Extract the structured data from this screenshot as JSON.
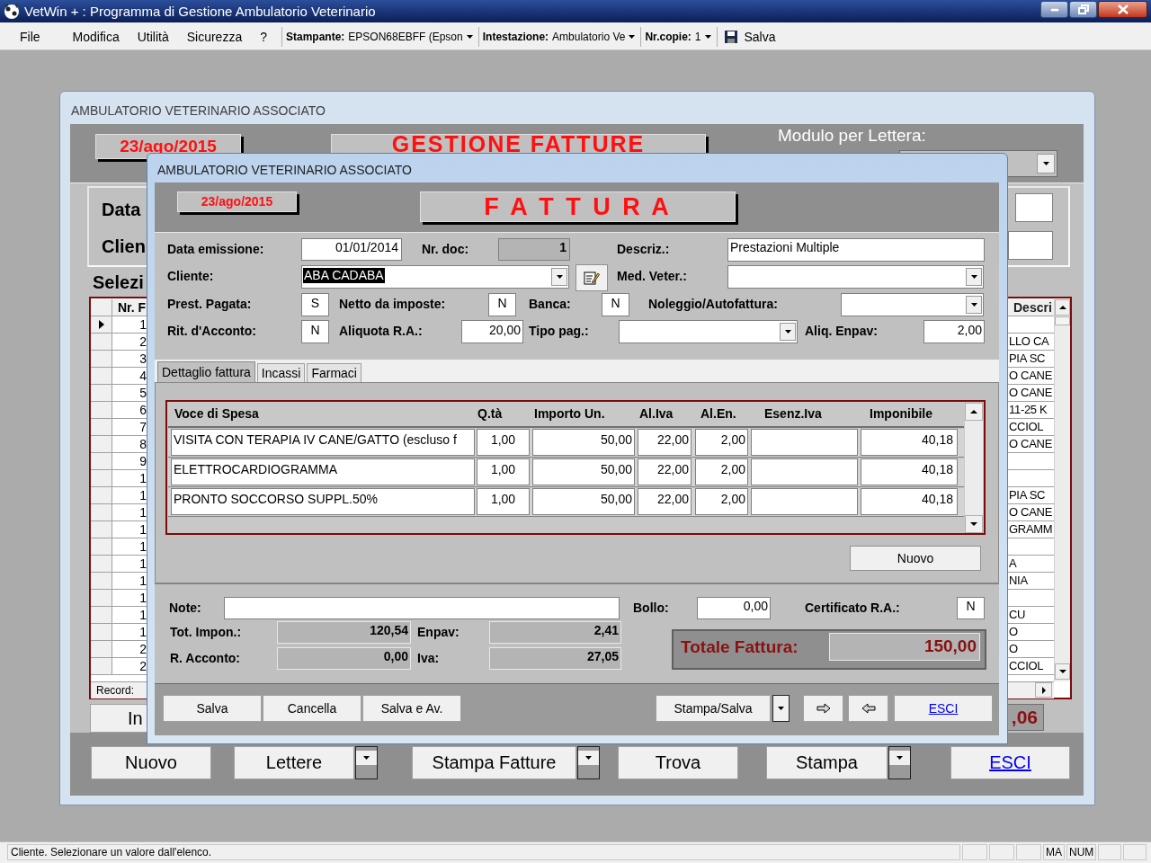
{
  "app": {
    "title": "VetWin + : Programma di Gestione Ambulatorio Veterinario"
  },
  "menu": [
    {
      "label": "File"
    },
    {
      "label": "Modifica"
    },
    {
      "label": "Utilità"
    },
    {
      "label": "Sicurezza"
    },
    {
      "label": "?"
    }
  ],
  "toolbar": [
    {
      "kind": "combo",
      "label": "Stampante:",
      "value": "EPSON68EBFF (Epson"
    },
    {
      "kind": "combo",
      "label": "Intestazione:",
      "value": "Ambulatorio Ve"
    },
    {
      "kind": "combo",
      "label": "Nr.copie:",
      "value": "1"
    },
    {
      "kind": "button",
      "label": "Salva"
    }
  ],
  "background_window": {
    "title": "AMBULATORIO VETERINARIO ASSOCIATO",
    "date": "23/ago/2015",
    "heading": "GESTIONE FATTURE",
    "modulo_label": "Modulo per Lettera:",
    "filter_labels": [
      "Data",
      "Clien"
    ],
    "list_label": "Selezi",
    "list": {
      "columns": [
        "Nr. F",
        "Descri"
      ],
      "rows": [
        {
          "nr": "1",
          "current": true
        },
        {
          "nr": "2",
          "descr": "LLO CA",
          "current": false
        },
        {
          "nr": "3",
          "descr": "PIA  SC",
          "current": false
        },
        {
          "nr": "4",
          "descr": "O CANE",
          "current": false
        },
        {
          "nr": "5",
          "descr": "O CANE",
          "current": false
        },
        {
          "nr": "6",
          "descr": "11-25 K",
          "current": false
        },
        {
          "nr": "7",
          "descr": "CCIOL",
          "current": false
        },
        {
          "nr": "8",
          "descr": "O CANE",
          "current": false
        },
        {
          "nr": "9",
          "current": false
        },
        {
          "nr": "1",
          "current": false
        },
        {
          "nr": "1",
          "descr": "PIA  SC",
          "current": false
        },
        {
          "nr": "1",
          "descr": "O CANE",
          "current": false
        },
        {
          "nr": "1",
          "descr": "GRAMM",
          "current": false
        },
        {
          "nr": "1",
          "current": false
        },
        {
          "nr": "1",
          "descr": "A",
          "current": false
        },
        {
          "nr": "1",
          "descr": "NIA",
          "current": false
        },
        {
          "nr": "1",
          "current": false
        },
        {
          "nr": "1",
          "descr": "CU",
          "current": false
        },
        {
          "nr": "1",
          "descr": "O",
          "current": false
        },
        {
          "nr": "2",
          "descr": "O",
          "current": false
        },
        {
          "nr": "2",
          "descr": "CCIOL",
          "current": false
        }
      ]
    },
    "record_label": "Record:",
    "partial_button": "In",
    "partial_total": ",06",
    "buttons": [
      {
        "kind": "button",
        "label": "Nuovo"
      },
      {
        "kind": "split",
        "label": "Lettere"
      },
      {
        "kind": "split",
        "label": "Stampa Fatture"
      },
      {
        "kind": "button",
        "label": "Trova"
      },
      {
        "kind": "split",
        "label": "Stampa"
      },
      {
        "kind": "link",
        "label": "ESCI"
      }
    ]
  },
  "dialog": {
    "title": "AMBULATORIO VETERINARIO ASSOCIATO",
    "date": "23/ago/2015",
    "heading": "F A T T U R A",
    "data_emissione": {
      "label": "Data emissione:",
      "value": "01/01/2014"
    },
    "nr_doc": {
      "label": "Nr. doc:",
      "value": "1"
    },
    "descrizione": {
      "label": "Descriz.:",
      "value": "Prestazioni Multiple"
    },
    "cliente": {
      "label": "Cliente:",
      "value": "ABA CADABA",
      "text_selected": true
    },
    "med_veter": {
      "label": "Med. Veter.:"
    },
    "prest_pagata": {
      "label": "Prest. Pagata:",
      "value": "S"
    },
    "netto": {
      "label": "Netto da imposte:",
      "value": "N"
    },
    "banca": {
      "label": "Banca:",
      "value": "N"
    },
    "noleggio": {
      "label": "Noleggio/Autofattura:"
    },
    "rit_acconto": {
      "label": "Rit. d'Acconto:",
      "value": "N"
    },
    "aliquota_ra": {
      "label": "Aliquota R.A.:",
      "value": "20,00"
    },
    "tipo_pag": {
      "label": "Tipo pag.:"
    },
    "aliq_enpav": {
      "label": "Aliq. Enpav:",
      "value": "2,00"
    },
    "tabs": [
      {
        "label": "Dettaglio fattura",
        "selected": true
      },
      {
        "label": "Incassi",
        "selected": false
      },
      {
        "label": "Farmaci",
        "selected": false
      }
    ],
    "detail": {
      "columns": [
        "Voce di Spesa",
        "Q.tà",
        "Importo Un.",
        "Al.Iva",
        "Al.En.",
        "Esenz.Iva",
        "Imponibile"
      ],
      "rows": [
        {
          "voce": "VISITA CON TERAPIA IV CANE/GATTO (escluso f",
          "qta": "1,00",
          "importo": "50,00",
          "al_iva": "22,00",
          "al_en": "2,00",
          "imponibile": "40,18"
        },
        {
          "voce": "ELETTROCARDIOGRAMMA",
          "qta": "1,00",
          "importo": "50,00",
          "al_iva": "22,00",
          "al_en": "2,00",
          "imponibile": "40,18"
        },
        {
          "voce": "PRONTO SOCCORSO  SUPPL.50%",
          "qta": "1,00",
          "importo": "50,00",
          "al_iva": "22,00",
          "al_en": "2,00",
          "imponibile": "40,18"
        }
      ]
    },
    "new_button": "Nuovo",
    "note": {
      "label": "Note:"
    },
    "bollo": {
      "label": "Bollo:",
      "value": "0,00"
    },
    "certificato_ra": {
      "label": "Certificato R.A.:",
      "value": "N"
    },
    "tot_impon": {
      "label": "Tot. Impon.:",
      "value": "120,54"
    },
    "enpav": {
      "label": "Enpav:",
      "value": "2,41"
    },
    "r_acconto": {
      "label": "R. Acconto:",
      "value": "0,00"
    },
    "iva": {
      "label": "Iva:",
      "value": "27,05"
    },
    "totale": {
      "label": "Totale Fattura:",
      "value": "150,00"
    },
    "buttons": [
      {
        "kind": "button",
        "label": "Salva"
      },
      {
        "kind": "button",
        "label": "Cancella"
      },
      {
        "kind": "button",
        "label": "Salva e Av."
      },
      {
        "kind": "split",
        "label": "Stampa/Salva"
      },
      {
        "kind": "next"
      },
      {
        "kind": "previous"
      },
      {
        "kind": "link",
        "label": "ESCI"
      }
    ]
  },
  "status_bar": {
    "message": "Cliente. Selezionare un valore dall'elenco.",
    "indicators": [
      "MA",
      "NUM"
    ]
  }
}
